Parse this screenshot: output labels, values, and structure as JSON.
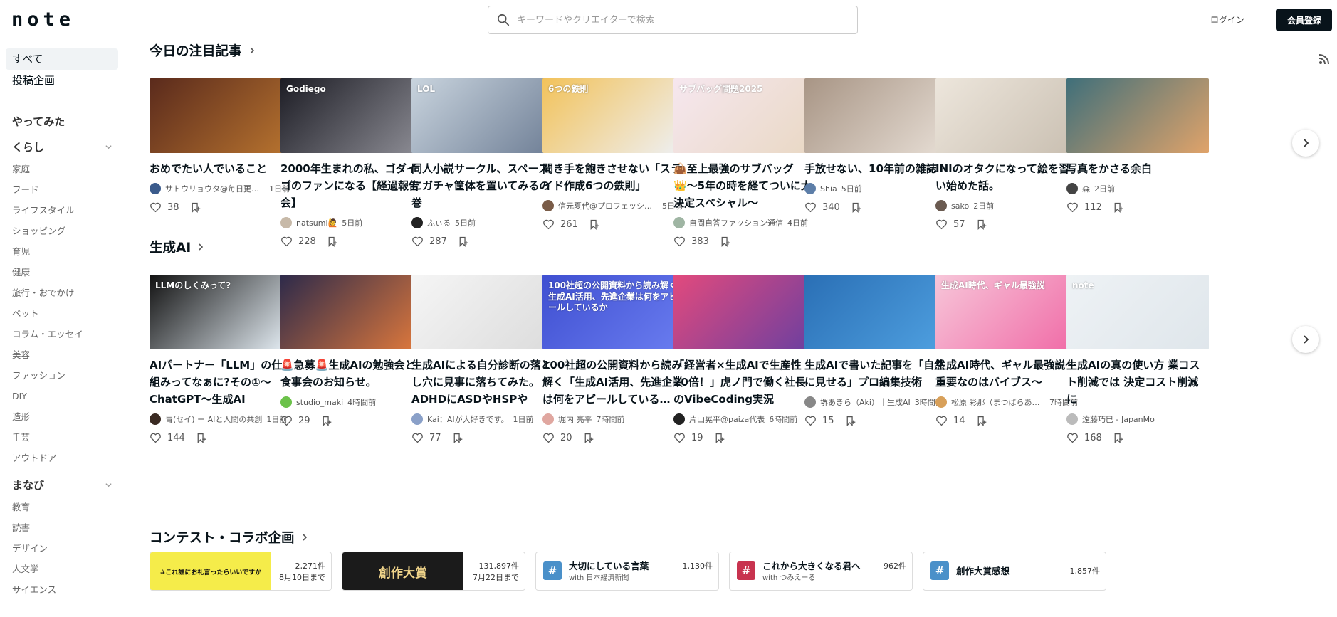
{
  "header": {
    "logo": "note",
    "search_placeholder": "キーワードやクリエイターで検索",
    "login": "ログイン",
    "signup": "会員登録"
  },
  "sidebar": {
    "top": [
      "すべて",
      "投稿企画"
    ],
    "groups": [
      {
        "label": "やってみた",
        "collapsible": false,
        "items": []
      },
      {
        "label": "くらし",
        "collapsible": true,
        "items": [
          "家庭",
          "フード",
          "ライフスタイル",
          "ショッピング",
          "育児",
          "健康",
          "旅行・おでかけ",
          "ペット",
          "コラム・エッセイ",
          "美容",
          "ファッション",
          "DIY",
          "造形",
          "手芸",
          "アウトドア"
        ]
      },
      {
        "label": "まなび",
        "collapsible": true,
        "items": [
          "教育",
          "読書",
          "デザイン",
          "人文学",
          "サイエンス"
        ]
      }
    ]
  },
  "sections": [
    {
      "title": "今日の注目記事",
      "cards": [
        {
          "title": "おめでたい人でいること",
          "author": "サトウリョウタ@毎日更新を続けるnoter",
          "time": "1日前",
          "likes": "38",
          "thumb_color": "#5a2a1c",
          "thumb_color2": "#b8742f",
          "thumb_label": "",
          "avatar_color": "#3b5b8c"
        },
        {
          "title": "2000年生まれの私、ゴダイゴのファンになる【経過報告会】",
          "author": "natsumi🙋",
          "time": "5日前",
          "likes": "228",
          "thumb_color": "#1c1c24",
          "thumb_color2": "#8e8e96",
          "thumb_label": "Godiego",
          "avatar_color": "#c7b9a8"
        },
        {
          "title": "同人小説サークル、スペースにガチャ筐体を置いてみるの巻",
          "author": "ふぃる",
          "time": "5日前",
          "likes": "287",
          "thumb_color": "#c9d4de",
          "thumb_color2": "#6f7f96",
          "thumb_label": "LOL",
          "avatar_color": "#222"
        },
        {
          "title": "聞き手を飽きさせない「スライド作成6つの鉄則」",
          "author": "信元夏代@プロフェッショナルスピーカー",
          "time": "5日前",
          "likes": "261",
          "thumb_color": "#f2c25a",
          "thumb_color2": "#eef0f4",
          "thumb_label": "6つの鉄則",
          "avatar_color": "#7a5c48"
        },
        {
          "title": "👜至上最強のサブバッグ👑〜5年の時を経てついに大決定スペシャル〜",
          "author": "自問自答ファッション通信",
          "time": "4日前",
          "likes": "383",
          "thumb_color": "#f6e7ef",
          "thumb_color2": "#e9d8c4",
          "thumb_label": "サブバッグ問題2025",
          "avatar_color": "#9fb5a3"
        },
        {
          "title": "手放せない、10年前の雑誌",
          "author": "Shia",
          "time": "5日前",
          "likes": "340",
          "thumb_color": "#a89585",
          "thumb_color2": "#e6ddd4",
          "thumb_label": "",
          "avatar_color": "#5d7ea8"
        },
        {
          "title": "INIのオタクになって絵を習い始めた話。",
          "author": "sako",
          "time": "2日前",
          "likes": "57",
          "thumb_color": "#ede6dc",
          "thumb_color2": "#c9bfb1",
          "thumb_label": "",
          "avatar_color": "#6a5a50"
        },
        {
          "title": "写真をかさる余白",
          "author": "森",
          "time": "2日前",
          "likes": "112",
          "thumb_color": "#3f6f7a",
          "thumb_color2": "#e0a36a",
          "thumb_label": "",
          "avatar_color": "#444"
        }
      ]
    },
    {
      "title": "生成AI",
      "cards": [
        {
          "title": "AIパートナー「LLM」の仕組みってなぁに?その①〜ChatGPT〜生成AI",
          "author": "青(セイ) ー AIと人間の共創",
          "time": "1日前",
          "likes": "144",
          "thumb_color": "#111",
          "thumb_color2": "#e9f2f9",
          "thumb_label": "LLMのしくみって?",
          "avatar_color": "#3a2a22"
        },
        {
          "title": "🚨急募🚨生成AIの勉強会と食事会のお知らせ。",
          "author": "studio_maki",
          "time": "4時間前",
          "likes": "29",
          "thumb_color": "#2d2a4a",
          "thumb_color2": "#e27a3c",
          "thumb_label": "",
          "avatar_color": "#6cc24a"
        },
        {
          "title": "生成AIによる自分診断の落とし穴に見事に落ちてみた。ADHDにASDやHSPやSLD…",
          "author": "Kai：AIが大好きです。",
          "time": "1日前",
          "likes": "77",
          "thumb_color": "#f5f5f5",
          "thumb_color2": "#dcdcdc",
          "thumb_label": "",
          "avatar_color": "#8aa0c8"
        },
        {
          "title": "100社超の公開資料から読み解く「生成AI活用、先進企業は何をアピールしている…",
          "author": "堀内 亮平",
          "time": "7時間前",
          "likes": "20",
          "thumb_color": "#3f4fd1",
          "thumb_color2": "#6a7df0",
          "thumb_label": "100社超の公開資料から読み解く 生成AI活用、先進企業は何をアピールしているか",
          "avatar_color": "#e0a7a0"
        },
        {
          "title": "「経営者×生成AIで生産性20倍！」虎ノ門で働く社長のVibeCoding実況",
          "author": "片山晃平@paiza代表",
          "time": "6時間前",
          "likes": "19",
          "thumb_color": "#e24a7d",
          "thumb_color2": "#6a3fa0",
          "thumb_label": "",
          "avatar_color": "#222"
        },
        {
          "title": "生成AIで書いた記事を「自然に見せる」プロ編集技術",
          "author": "堺あきら（Aki）｜生成AI",
          "time": "3時間前",
          "likes": "15",
          "thumb_color": "#2a6fb5",
          "thumb_color2": "#4fa0e0",
          "thumb_label": "",
          "avatar_color": "#888"
        },
        {
          "title": "生成AI時代、ギャル最強説〜重要なのはバイブス〜",
          "author": "松原 彩那（まつばらあやな）",
          "time": "7時間前",
          "likes": "14",
          "thumb_color": "#f7c6d9",
          "thumb_color2": "#f06aa6",
          "thumb_label": "生成AI時代、ギャル最強説",
          "avatar_color": "#d8a05a"
        },
        {
          "title": "生成AIの真の使い方 業コスト削減では 決定コスト削減に",
          "author": "遠藤巧巳 - JapanMo",
          "time": "",
          "likes": "168",
          "thumb_color": "#eef2f5",
          "thumb_color2": "#dfe6eb",
          "thumb_label": "note",
          "avatar_color": "#bbb"
        }
      ]
    }
  ],
  "contests_title": "コンテスト・コラボ企画",
  "contests": [
    {
      "kind": "banner",
      "banner_text": "#これ誰にお礼言ったらいいですか",
      "banner_color": "#f5ec4a",
      "count": "2,271件",
      "deadline": "8月10日まで"
    },
    {
      "kind": "banner",
      "banner_text": "創作大賞",
      "banner_color": "#1b1b1b",
      "count": "131,897件",
      "deadline": "7月22日まで"
    },
    {
      "kind": "tag",
      "text": "大切にしている言葉",
      "with": "with 日本経済新聞",
      "count": "1,130件",
      "hash_color": "#4a90c9"
    },
    {
      "kind": "tag",
      "text": "これから大きくなる君へ",
      "with": "with つみえーる",
      "count": "962件",
      "hash_color": "#c8334f"
    },
    {
      "kind": "tag",
      "text": "創作大賞感想",
      "with": "",
      "count": "1,857件",
      "hash_color": "#4a90c9"
    }
  ]
}
